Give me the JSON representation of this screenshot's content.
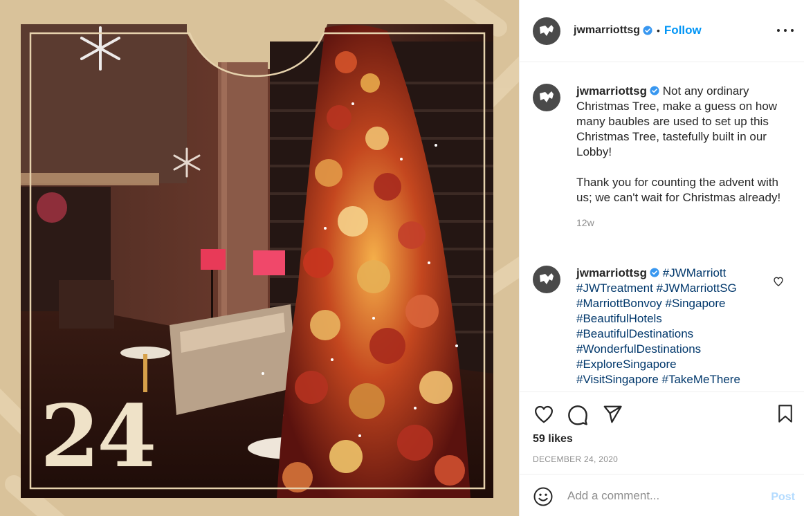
{
  "post": {
    "image_alt": "Christmas tree of red and gold baubles in a hotel lobby",
    "day_number": "24"
  },
  "header": {
    "username": "jwmarriottsg",
    "separator": "•",
    "follow_label": "Follow"
  },
  "caption": {
    "username": "jwmarriottsg",
    "text": "Not any ordinary Christmas Tree, make a guess on how many baubles are used to set up this Christmas Tree, tastefully built in our Lobby!\n\nThank you for counting the advent with us; we can't wait for Christmas already!",
    "time": "12w"
  },
  "comment": {
    "username": "jwmarriottsg",
    "hashtags": [
      "#JWMarriott",
      "#JWTreatment",
      "#JWMarriottSG",
      "#MarriottBonvoy",
      "#Singapore",
      "#BeautifulHotels",
      "#BeautifulDestinations",
      "#WonderfulDestinations",
      "#ExploreSingapore",
      "#VisitSingapore",
      "#TakeMeThere"
    ]
  },
  "stats": {
    "likes": "59 likes",
    "date": "DECEMBER 24, 2020"
  },
  "add_comment": {
    "placeholder": "Add a comment...",
    "post_label": "Post"
  },
  "colors": {
    "link_blue": "#0095f6",
    "hashtag": "#00376b",
    "frame_beige": "#d9c29a",
    "muted_text": "#8e8e8e"
  }
}
